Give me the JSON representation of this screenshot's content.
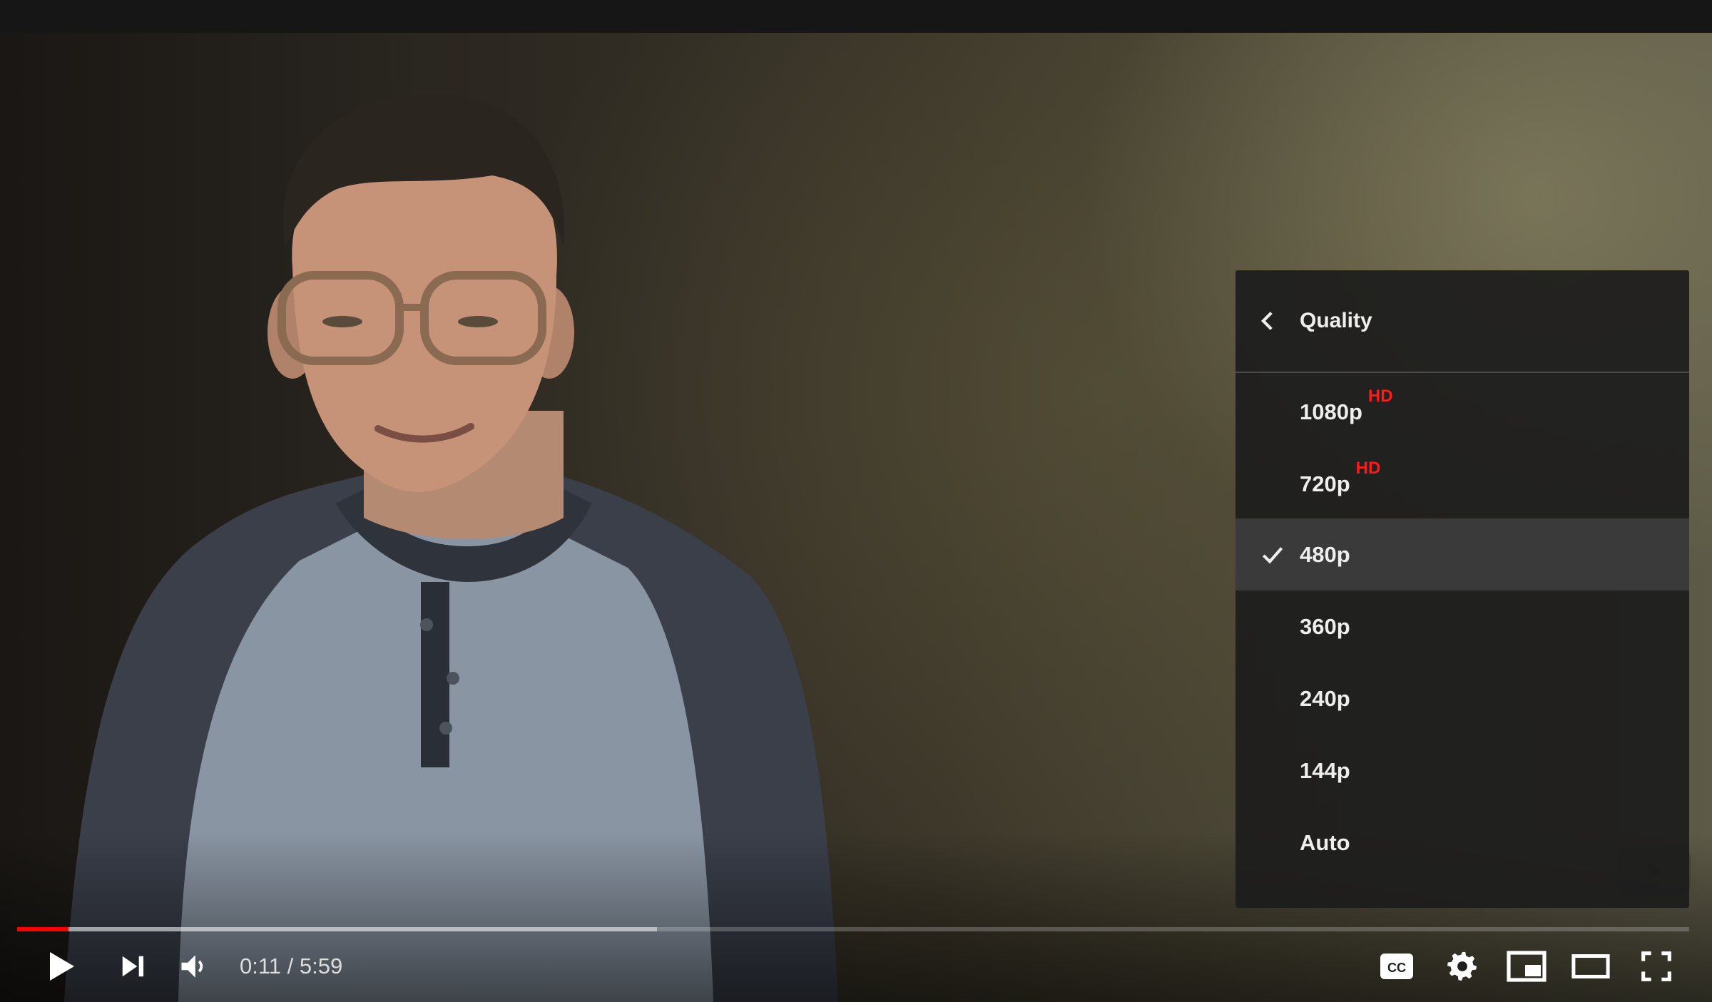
{
  "player": {
    "current_time": "0:11",
    "separator": " / ",
    "duration": "5:59",
    "progress_played_fraction": 0.0306,
    "progress_buffered_fraction": 0.3826,
    "colors": {
      "accent": "#ff0000",
      "menu_bg": "#1c1c1c",
      "hd_badge": "#ff1a1a"
    }
  },
  "quality_menu": {
    "title": "Quality",
    "back_icon": "chevron-left-icon",
    "selected": "480p",
    "options": [
      {
        "label": "1080p",
        "badge": "HD"
      },
      {
        "label": "720p",
        "badge": "HD"
      },
      {
        "label": "480p",
        "badge": ""
      },
      {
        "label": "360p",
        "badge": ""
      },
      {
        "label": "240p",
        "badge": ""
      },
      {
        "label": "144p",
        "badge": ""
      },
      {
        "label": "Auto",
        "badge": ""
      }
    ]
  },
  "controls": {
    "icons": [
      "play-icon",
      "next-icon",
      "volume-icon",
      "captions-icon",
      "settings-icon",
      "miniplayer-icon",
      "theater-mode-icon",
      "fullscreen-icon"
    ]
  }
}
